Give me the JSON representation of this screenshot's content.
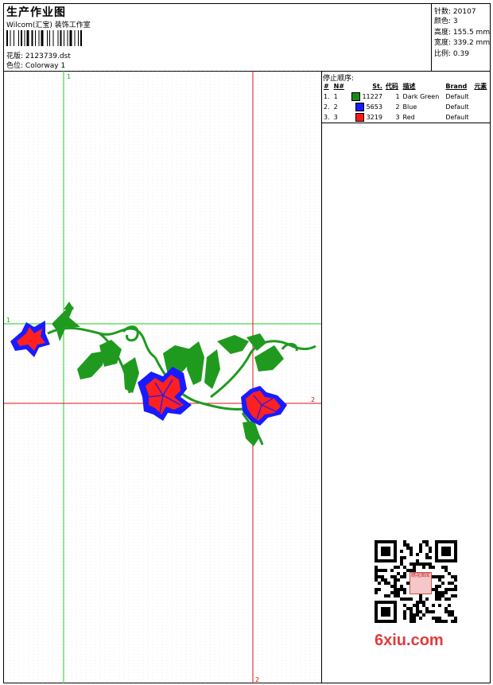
{
  "header": {
    "title": "生产作业图",
    "subtitle": "Wilcom(汇宝) 装饰工作室",
    "design_label": "花版:",
    "design_value": "2123739.dst",
    "colorway_label": "色位:",
    "colorway_value": "Colorway 1"
  },
  "stats": [
    {
      "label": "针数:",
      "value": "20107"
    },
    {
      "label": "颜色:",
      "value": "3"
    },
    {
      "label": "高度:",
      "value": "155.5 mm"
    },
    {
      "label": "宽度:",
      "value": "339.2 mm"
    },
    {
      "label": "比例:",
      "value": "0.39"
    }
  ],
  "guides": {
    "green_1": "1",
    "green_1b": "1",
    "red_2": "2",
    "red_2b": "2"
  },
  "stop_sequence": {
    "title": "停止顺序:",
    "columns": [
      "#",
      "N#",
      "St.",
      "代码",
      "描述",
      "Brand",
      "元素"
    ],
    "rows": [
      {
        "num": "1.",
        "n": "1",
        "color": "#1a8a1a",
        "stitches": "11227",
        "code": "1",
        "desc": "Dark Green",
        "brand": "Default"
      },
      {
        "num": "2.",
        "n": "2",
        "color": "#1a1aff",
        "stitches": "5653",
        "code": "2",
        "desc": "Blue",
        "brand": "Default"
      },
      {
        "num": "3.",
        "n": "3",
        "color": "#ff1a1a",
        "stitches": "3219",
        "code": "3",
        "desc": "Red",
        "brand": "Default"
      }
    ]
  },
  "watermark": {
    "text": "6xiu.com",
    "seal": "绣花图库"
  },
  "colors": {
    "guide_green": "#22cc22",
    "guide_red": "#e01010",
    "leaf_green": "#1f9a1f",
    "flower_blue": "#1a1aff",
    "flower_red": "#ff2020"
  }
}
